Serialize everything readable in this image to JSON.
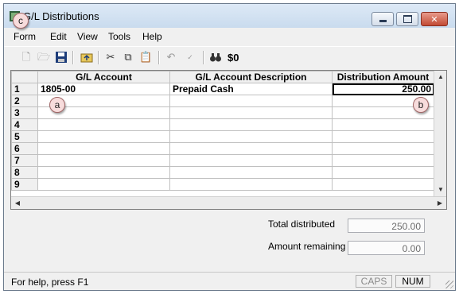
{
  "window": {
    "title": "G/L Distributions"
  },
  "menu": [
    "Form",
    "Edit",
    "View",
    "Tools",
    "Help"
  ],
  "toolbar": {
    "icons": [
      "new-document-icon",
      "open-folder-icon",
      "save-icon",
      "import-folder-icon",
      "cut-icon",
      "copy-icon",
      "paste-icon",
      "undo-icon",
      "spell-check-icon",
      "find-icon"
    ],
    "zero_dollar_label": "$0"
  },
  "grid": {
    "columns": [
      "G/L Account",
      "G/L Account Description",
      "Distribution Amount"
    ],
    "rows": [
      {
        "num": "1",
        "account": "1805-00",
        "description": "Prepaid Cash",
        "amount": "250.00"
      },
      {
        "num": "2",
        "account": "",
        "description": "",
        "amount": ""
      },
      {
        "num": "3",
        "account": "",
        "description": "",
        "amount": ""
      },
      {
        "num": "4",
        "account": "",
        "description": "",
        "amount": ""
      },
      {
        "num": "5",
        "account": "",
        "description": "",
        "amount": ""
      },
      {
        "num": "6",
        "account": "",
        "description": "",
        "amount": ""
      },
      {
        "num": "7",
        "account": "",
        "description": "",
        "amount": ""
      },
      {
        "num": "8",
        "account": "",
        "description": "",
        "amount": ""
      },
      {
        "num": "9",
        "account": "",
        "description": "",
        "amount": ""
      }
    ]
  },
  "callouts": {
    "a": "a",
    "b": "b",
    "c": "c"
  },
  "summary": {
    "total_label": "Total distributed",
    "total_value": "250.00",
    "remaining_label": "Amount remaining",
    "remaining_value": "0.00"
  },
  "status": {
    "help_text": "For help, press F1",
    "caps": "CAPS",
    "num": "NUM"
  },
  "colors": {
    "close_button": "#c24a34",
    "callout_fill": "#f7dcdc"
  }
}
